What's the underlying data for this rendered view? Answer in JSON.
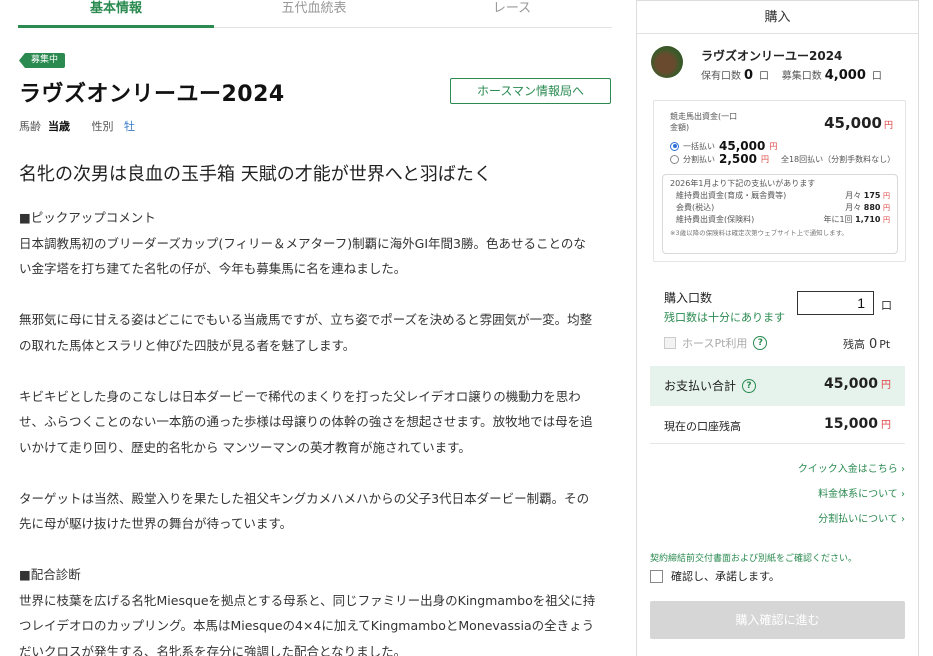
{
  "tabs": [
    "基本情報",
    "五代血統表",
    "レース"
  ],
  "horse": {
    "status_badge": "募集中",
    "name": "ラヴズオンリーユー2024",
    "hm_button": "ホースマン情報局へ",
    "age_label": "馬齢",
    "age_value": "当歳",
    "sex_label": "性別",
    "sex_value": "牡"
  },
  "article": {
    "headline": "名牝の次男は良血の玉手箱 天賦の才能が世界へと羽ばたく",
    "pickup_heading": "■ピックアップコメント",
    "p1a": "日本調教馬初のブリーダーズカップ(フィリー＆メアターフ)制覇に海外GI年間3勝。色あせることのな",
    "p1b": "い金字塔を打ち建てた名牝の仔が、今年も募集馬に名を連ねました。",
    "p2a": "無邪気に母に甘える姿はどこにでもいる当歳馬ですが、立ち姿でポーズを決めると雰囲気が一変。均整",
    "p2b": "の取れた馬体とスラリと伸びた四肢が見る者を魅了します。",
    "p3a": "キビキビとした身のこなしは日本ダービーで稀代のまくりを打った父レイデオロ譲りの機動力を思わ",
    "p3b": "せ、ふらつくことのない一本筋の通った歩様は母譲りの体幹の強さを想起させます。放牧地では母を追",
    "p3c": "いかけて走り回り、歴史的名牝から マンツーマンの英才教育が施されています。",
    "p4a": "ターゲットは当然、殿堂入りを果たした祖父キングカメハメハからの父子3代日本ダービー制覇。その",
    "p4b": "先に母が駆け抜けた世界の舞台が待っています。",
    "pedigree_heading": "■配合診断",
    "p5a": "世界に枝葉を広げる名牝Miesqueを拠点とする母系と、同じファミリー出身のKingmamboを祖父に持",
    "p5b": "つレイデオロのカップリング。本馬はMiesqueの4×4に加えてKingmamboとMonevassiaの全きょう",
    "p5c": "だいクロスが発生する、名牝系を存分に強調した配合となりました。"
  },
  "purchase": {
    "title": "購入",
    "horse_name": "ラヴズオンリーユー2024",
    "owned_label": "保有口数",
    "owned_value": "0",
    "owned_unit": "口",
    "offered_label": "募集口数",
    "offered_value": "4,000",
    "offered_unit": "口",
    "price_label": "競走馬出資金(一口金額)",
    "price_value": "45,000",
    "yen": "円",
    "lump_label": "一括払い",
    "lump_value": "45,000",
    "split_label": "分割払い",
    "split_value": "2,500",
    "split_note": "全18回払い（分割手数料なし）",
    "fee_title": "2026年1月より下記の支払いがあります",
    "fee_rows": [
      {
        "label": "維持費出資金(育成・厩舎費等)",
        "period": "月々",
        "value": "175"
      },
      {
        "label": "会費(税込)",
        "period": "月々",
        "value": "880"
      },
      {
        "label": "維持費出資金(保険料)",
        "period": "年に1回",
        "value": "1,710"
      }
    ],
    "fee_note": "※3歳以降の保険料は確定次第ウェブサイト上で通知します。",
    "qty_label": "購入口数",
    "qty_stock": "残口数は十分にあります",
    "qty_value": "1",
    "qty_unit": "口",
    "pt_label": "ホースPt利用",
    "pt_balance_label": "残高",
    "pt_balance_value": "0",
    "pt_unit": "Pt",
    "total_label": "お支払い合計",
    "total_value": "45,000",
    "balance_label": "現在の口座残高",
    "balance_value": "15,000",
    "link_quick": "クイック入金はこちら ›",
    "link_fees": "料金体系について ›",
    "link_split": "分割払いについて ›",
    "confirm_note": "契約締結前交付書面および別紙をご確認ください。",
    "confirm_label": "確認し、承諾します。",
    "proceed_label": "購入確認に進む"
  },
  "colors": {
    "accent": "#2a8a50",
    "yen": "#d44444",
    "total_bg": "#e6f3ec"
  }
}
